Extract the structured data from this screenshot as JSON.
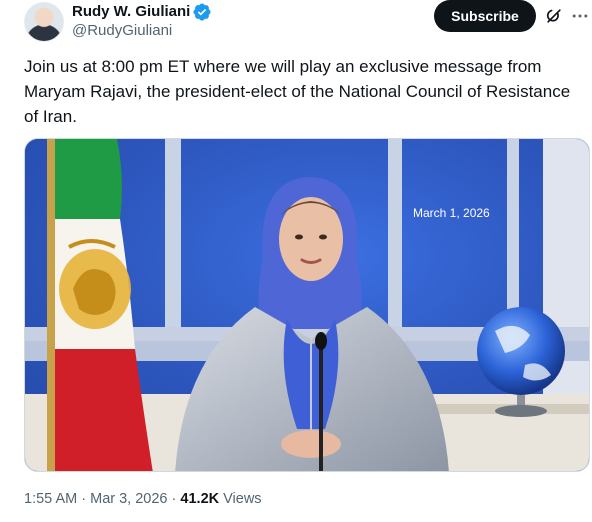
{
  "author": {
    "name": "Rudy W. Giuliani",
    "handle": "@RudyGiuliani",
    "verified_color": "#1d9bf0"
  },
  "actions": {
    "subscribe_label": "Subscribe",
    "grok_icon": "grok-icon"
  },
  "tweet": {
    "text": "Join us at 8:00 pm ET where we will play an exclusive message from Maryam Rajavi, the president-elect of the National Council of Resistance of Iran."
  },
  "media": {
    "overlay_date": "March 1, 2026",
    "backdrop_color": "#2f5bd0"
  },
  "meta": {
    "time": "1:55 AM",
    "date": "Mar 3, 2026",
    "separator": "·",
    "views_count": "41.2K",
    "views_label": "Views"
  }
}
